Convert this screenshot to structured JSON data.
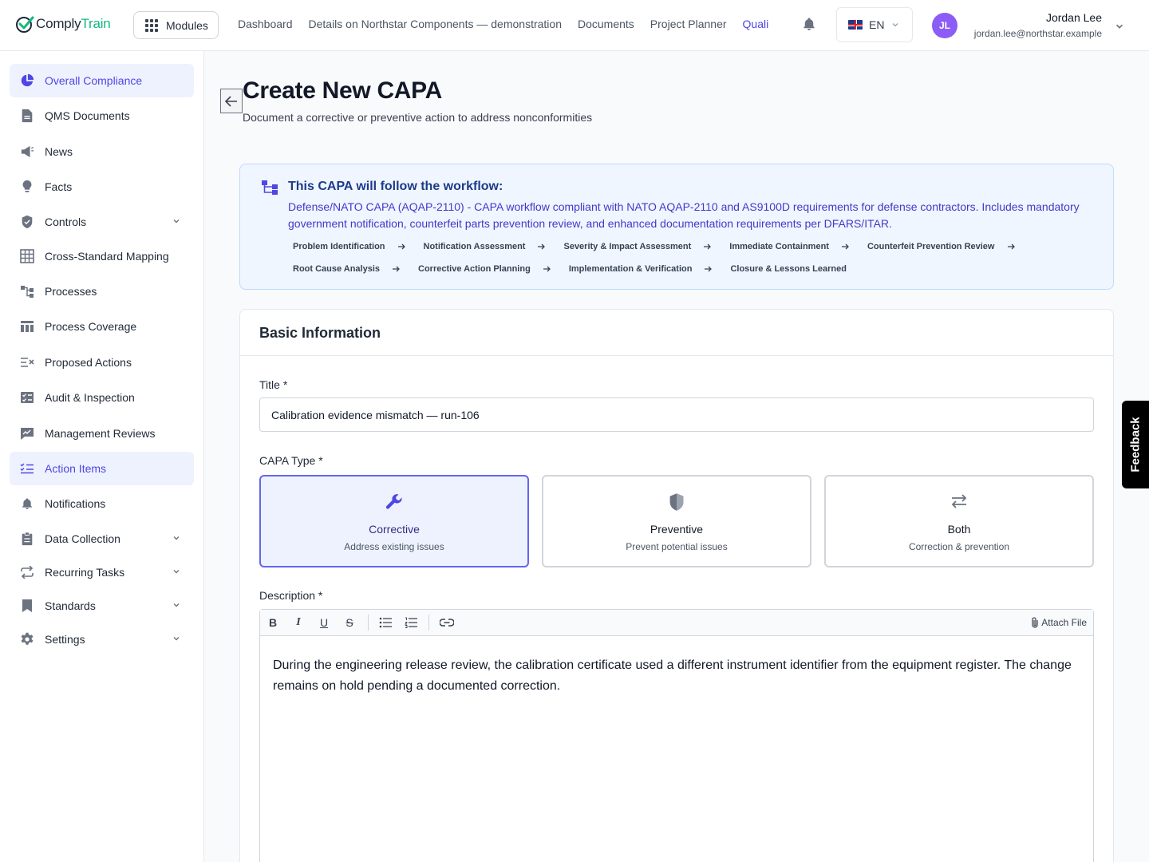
{
  "app": {
    "logo_part1": "Comply",
    "logo_part2": "Train",
    "brand_color": "#10b981",
    "accent_color": "#4f46e5"
  },
  "topbar": {
    "modules_label": "Modules",
    "nav": [
      {
        "label": "Dashboard",
        "active": false
      },
      {
        "label": "Details on Northstar Components — demonstration",
        "active": false
      },
      {
        "label": "Documents",
        "active": false
      },
      {
        "label": "Project Planner",
        "active": false
      },
      {
        "label": "Quali",
        "active": true
      }
    ],
    "language": "EN",
    "user": {
      "initials": "JL",
      "name": "Jordan Lee",
      "email": "jordan.lee@northstar.example"
    }
  },
  "sidebar": {
    "items": [
      {
        "label": "Overall Compliance",
        "icon": "pie-chart-icon",
        "active": true,
        "expandable": false
      },
      {
        "label": "QMS Documents",
        "icon": "document-icon",
        "active": false,
        "expandable": false
      },
      {
        "label": "News",
        "icon": "megaphone-icon",
        "active": false,
        "expandable": false
      },
      {
        "label": "Facts",
        "icon": "lightbulb-icon",
        "active": false,
        "expandable": false
      },
      {
        "label": "Controls",
        "icon": "shield-icon",
        "active": false,
        "expandable": true
      },
      {
        "label": "Cross-Standard Mapping",
        "icon": "table-grid-icon",
        "active": false,
        "expandable": false
      },
      {
        "label": "Processes",
        "icon": "flow-icon",
        "active": false,
        "expandable": false
      },
      {
        "label": "Process Coverage",
        "icon": "columns-icon",
        "active": false,
        "expandable": false
      },
      {
        "label": "Proposed Actions",
        "icon": "list-x-icon",
        "active": false,
        "expandable": false
      },
      {
        "label": "Audit & Inspection",
        "icon": "checklist-icon",
        "active": false,
        "expandable": false
      },
      {
        "label": "Management Reviews",
        "icon": "chart-review-icon",
        "active": false,
        "expandable": false
      },
      {
        "label": "Action Items",
        "icon": "list-check-icon",
        "active": true,
        "expandable": false
      },
      {
        "label": "Notifications",
        "icon": "bell-icon",
        "active": false,
        "expandable": false
      },
      {
        "label": "Data Collection",
        "icon": "clipboard-icon",
        "active": false,
        "expandable": true
      },
      {
        "label": "Recurring Tasks",
        "icon": "repeat-icon",
        "active": false,
        "expandable": true
      },
      {
        "label": "Standards",
        "icon": "bookmark-icon",
        "active": false,
        "expandable": true
      },
      {
        "label": "Settings",
        "icon": "gear-icon",
        "active": false,
        "expandable": true
      }
    ]
  },
  "page": {
    "title": "Create New CAPA",
    "subtitle": "Document a corrective or preventive action to address nonconformities"
  },
  "workflow": {
    "title": "This CAPA will follow the workflow:",
    "description": "Defense/NATO CAPA (AQAP-2110) - CAPA workflow compliant with NATO AQAP-2110 and AS9100D requirements for defense contractors. Includes mandatory government notification, counterfeit parts prevention review, and enhanced documentation requirements per DFARS/ITAR.",
    "steps": [
      "Problem Identification",
      "Notification Assessment",
      "Severity & Impact Assessment",
      "Immediate Containment",
      "Counterfeit Prevention Review",
      "Root Cause Analysis",
      "Corrective Action Planning",
      "Implementation & Verification",
      "Closure & Lessons Learned"
    ]
  },
  "form": {
    "section_title": "Basic Information",
    "title_label": "Title *",
    "title_value": "Calibration evidence mismatch — run-106",
    "type_label": "CAPA Type *",
    "types": [
      {
        "name": "Corrective",
        "description": "Address existing issues",
        "selected": true
      },
      {
        "name": "Preventive",
        "description": "Prevent potential issues",
        "selected": false
      },
      {
        "name": "Both",
        "description": "Correction & prevention",
        "selected": false
      }
    ],
    "description_label": "Description *",
    "attach_label": "Attach File",
    "description_text": "During the engineering release review, the calibration certificate used a different instrument identifier from the equipment register. The change remains on hold pending a documented correction."
  },
  "feedback_label": "Feedback"
}
